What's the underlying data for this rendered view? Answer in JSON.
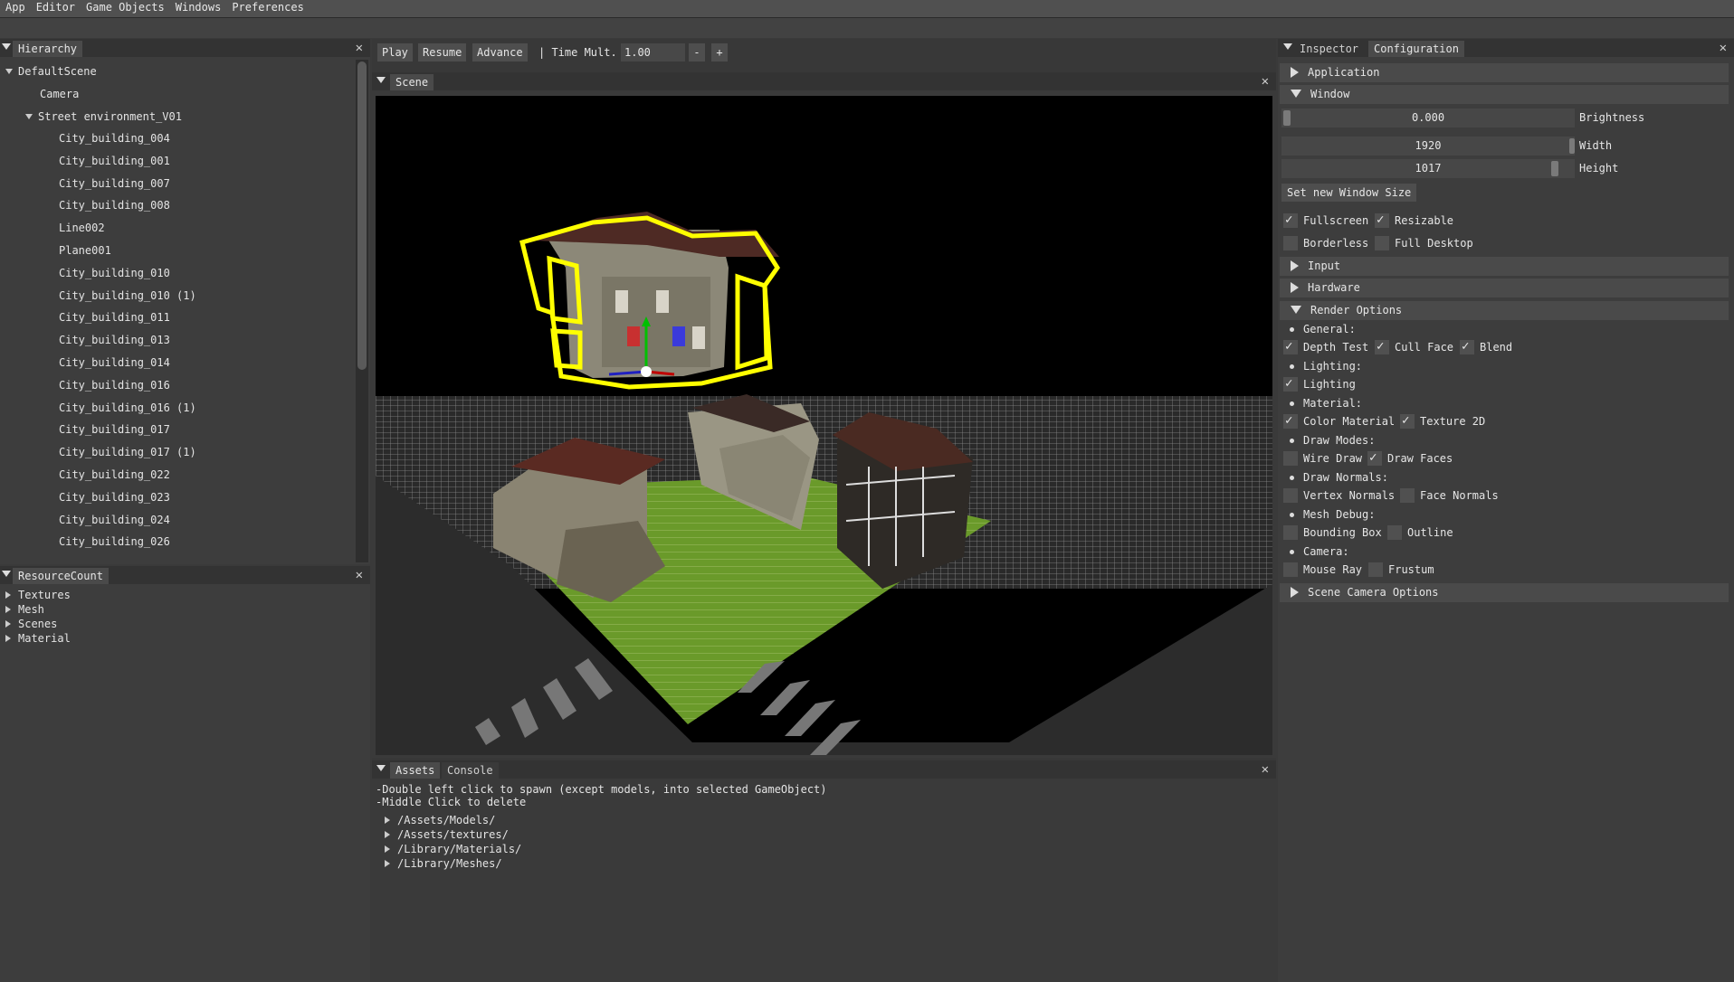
{
  "menu": [
    "App",
    "Editor",
    "Game Objects",
    "Windows",
    "Preferences"
  ],
  "hierarchy": {
    "tab": "Hierarchy",
    "close": "✕",
    "root": "DefaultScene",
    "camera": "Camera",
    "group": "Street environment_V01",
    "children": [
      "City_building_004",
      "City_building_001",
      "City_building_007",
      "City_building_008",
      "Line002",
      "Plane001",
      "City_building_010",
      "City_building_010 (1)",
      "City_building_011",
      "City_building_013",
      "City_building_014",
      "City_building_016",
      "City_building_016 (1)",
      "City_building_017",
      "City_building_017 (1)",
      "City_building_022",
      "City_building_023",
      "City_building_024",
      "City_building_026"
    ]
  },
  "resources": {
    "tab": "ResourceCount",
    "close": "✕",
    "items": [
      "Textures",
      "Mesh",
      "Scenes",
      "Material"
    ]
  },
  "toolbar": {
    "play": "Play",
    "resume": "Resume",
    "advance": "Advance",
    "time_label": "| Time Mult.",
    "time_value": "1.00",
    "minus": "-",
    "plus": "+"
  },
  "scene": {
    "tab": "Scene",
    "close": "✕"
  },
  "assets": {
    "tab_assets": "Assets",
    "tab_console": "Console",
    "close": "✕",
    "help1": "-Double left click to spawn (except models, into selected GameObject)",
    "help2": "-Middle Click to delete",
    "folders": [
      "/Assets/Models/",
      "/Assets/textures/",
      "/Library/Materials/",
      "/Library/Meshes/"
    ]
  },
  "inspector": {
    "tab_inspector": "Inspector",
    "tab_configuration": "Configuration",
    "close": "✕",
    "application": "Application",
    "window": "Window",
    "brightness_value": "0.000",
    "brightness_label": "Brightness",
    "brightness_level": 0.0,
    "width_value": "1920",
    "width_label": "Width",
    "height_value": "1017",
    "height_label": "Height",
    "set_size": "Set new Window Size",
    "fullscreen": "Fullscreen",
    "resizable": "Resizable",
    "borderless": "Borderless",
    "full_desktop": "Full Desktop",
    "input": "Input",
    "hardware": "Hardware",
    "render_options": "Render Options",
    "general": "General:",
    "depth_test": "Depth Test",
    "cull_face": "Cull Face",
    "blend": "Blend",
    "lighting_h": "Lighting:",
    "lighting": "Lighting",
    "material_h": "Material:",
    "color_material": "Color Material",
    "texture_2d": "Texture 2D",
    "draw_modes": "Draw Modes:",
    "wire_draw": "Wire Draw",
    "draw_faces": "Draw Faces",
    "draw_normals": "Draw Normals:",
    "vertex_normals": "Vertex Normals",
    "face_normals": "Face Normals",
    "mesh_debug": "Mesh Debug:",
    "bounding_box": "Bounding Box",
    "outline": "Outline",
    "camera_h": "Camera:",
    "mouse_ray": "Mouse Ray",
    "frustum": "Frustum",
    "scene_camera": "Scene Camera Options",
    "check": "✓"
  },
  "colors": {
    "selection_outline": "#ffff00",
    "grass": "#6a9a2a",
    "panel": "#3d3d3d"
  }
}
